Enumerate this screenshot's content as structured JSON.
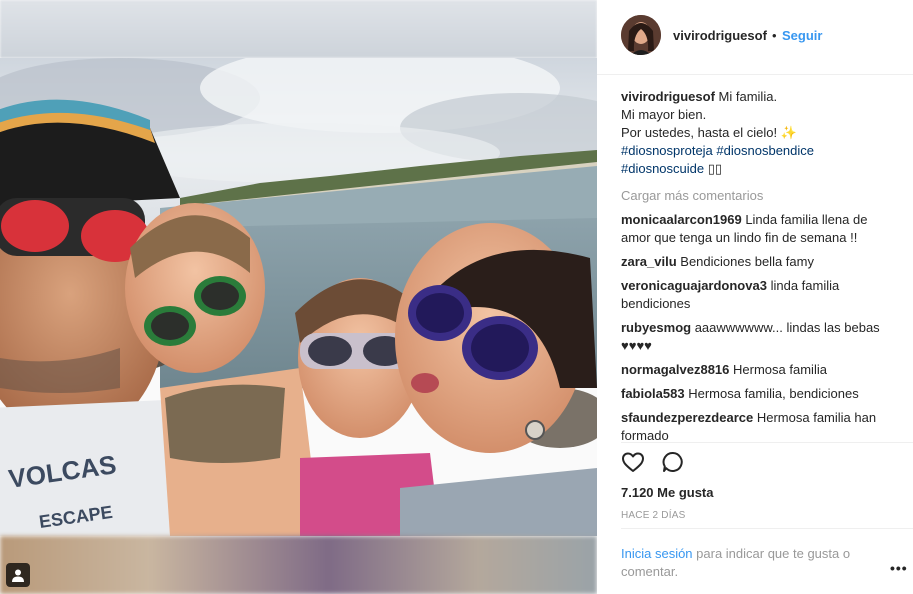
{
  "post": {
    "username": "vivirodriguesof",
    "follow_label": "Seguir",
    "separator": "•"
  },
  "caption": {
    "username": "vivirodriguesof",
    "line1": "Mi familia.",
    "line2": "Mi mayor bien.",
    "line3": "Por ustedes, hasta el cielo! ✨",
    "tag1": "#diosnosproteja",
    "tag2": "#diosnosbendice",
    "tag3": "#diosnoscuide",
    "tag3_suffix": " ▯▯"
  },
  "load_more": "Cargar más comentarios",
  "comments": [
    {
      "user": "monicaalarcon1969",
      "text": "Linda familia llena de amor que tenga un lindo fin de semana !!"
    },
    {
      "user": "zara_vilu",
      "text": "Bendiciones bella famy"
    },
    {
      "user": "veronicaguajardonova3",
      "text": "linda familia bendiciones"
    },
    {
      "user": "rubyesmog",
      "text": "aaawwwwww... lindas las bebas ♥♥♥♥"
    },
    {
      "user": "normagalvez8816",
      "text": "Hermosa familia"
    },
    {
      "user": "fabiola583",
      "text": "Hermosa familia, bendiciones"
    },
    {
      "user": "sfaundezperezdearce",
      "text": "Hermosa familia han formado"
    }
  ],
  "icons": {
    "like": "heart-icon",
    "comment": "comment-bubble-icon",
    "user_tag": "user-tag-icon",
    "more": "more-options-icon"
  },
  "likes": "7.120 Me gusta",
  "date": "HACE 2 DÍAS",
  "login": {
    "link": "Inicia sesión",
    "text": " para indicar que te gusta o comentar."
  },
  "more_label": "•••",
  "colors": {
    "link_blue": "#3897f0",
    "hashtag": "#003569",
    "muted": "#999999",
    "text": "#262626"
  }
}
